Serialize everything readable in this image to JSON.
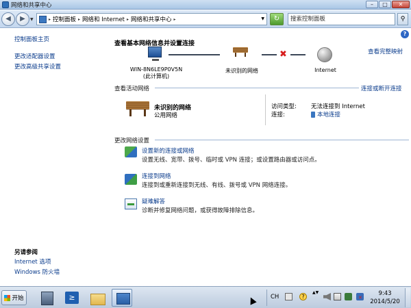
{
  "window": {
    "title": "网络和共享中心",
    "controls": {
      "minimize": "–",
      "maximize": "□",
      "close": "✕"
    }
  },
  "nav": {
    "back": "◀",
    "forward": "▶",
    "breadcrumbs": [
      "控制面板",
      "网络和 Internet",
      "网络和共享中心"
    ],
    "search_placeholder": "搜索控制面板",
    "refresh_symbol": "↻",
    "search_symbol": "⚲"
  },
  "sidebar": {
    "links": [
      "控制面板主页",
      "更改适配器设置",
      "更改高级共享设置"
    ],
    "see_also_title": "另请参阅",
    "see_also": [
      "Internet 选项",
      "Windows 防火墙"
    ]
  },
  "main": {
    "title": "查看基本网络信息并设置连接",
    "full_map": "查看完整映射",
    "map": {
      "computer_label_line1": "WIN-8N6LE9P0V5N",
      "computer_label_line2": "(此计算机)",
      "network_label": "未识别的网络",
      "internet_label": "Internet",
      "broken": "✖"
    },
    "active": {
      "title": "查看活动网络",
      "toggle_link": "连接或断开连接",
      "network_name": "未识别的网络",
      "network_type": "公用网络",
      "access_key": "访问类型:",
      "access_value": "无法连接到 Internet",
      "connection_key": "连接:",
      "connection_value": "本地连接"
    },
    "change": {
      "title": "更改网络设置",
      "tasks": [
        {
          "icon": "network-setup-icon",
          "link": "设置新的连接或网络",
          "desc": "设置无线、宽带、拨号、临时或 VPN 连接；或设置路由器或访问点。"
        },
        {
          "icon": "connect-network-icon",
          "link": "连接到网络",
          "desc": "连接到或重新连接到无线、有线、拨号或 VPN 网络连接。"
        },
        {
          "icon": "troubleshoot-icon",
          "link": "疑难解答",
          "desc": "诊断并修复网络问题，或获得故障排除信息。"
        }
      ]
    }
  },
  "taskbar": {
    "start_label": "开始",
    "language": "CH",
    "time": "9:43",
    "date": "2014/5/20",
    "help": "?",
    "tray_expand": "▲▼"
  },
  "colors": {
    "link": "#0b3c8c",
    "titlebar": "#a9c6e6",
    "taskbar": "#bccbde"
  }
}
